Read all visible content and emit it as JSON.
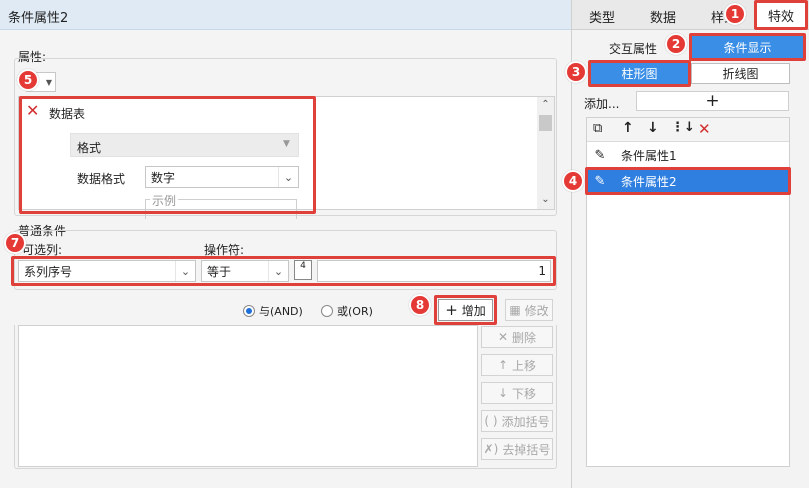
{
  "dialog_title": "条件属性2",
  "left": {
    "properties_label": "属性:",
    "datasheet_label": "数据表",
    "format_label": "格式",
    "data_format_label": "数据格式",
    "data_format_value": "数字",
    "example_label": "示例",
    "common_conditions_label": "普通条件",
    "filter_column_label": "可选列:",
    "filter_column_value": "系列序号",
    "operator_label": "操作符:",
    "operator_value": "等于",
    "value_input": "1",
    "and_label": "与(AND)",
    "or_label": "或(OR)",
    "add_label": "增加",
    "modify_label": "修改",
    "delete_label": "删除",
    "move_up_label": "上移",
    "move_down_label": "下移",
    "add_bracket_label": "添加括号",
    "remove_bracket_label": "去掉括号"
  },
  "right": {
    "tabs": [
      "类型",
      "数据",
      "样式",
      "特效"
    ],
    "sub_tabs": [
      "交互属性",
      "条件显示"
    ],
    "chart_tabs": [
      "柱形图",
      "折线图"
    ],
    "add_label": "添加...",
    "add_button": "+",
    "items": [
      "条件属性1",
      "条件属性2"
    ]
  },
  "badges": [
    "1",
    "2",
    "3",
    "4",
    "5",
    "7",
    "8"
  ],
  "colors": {
    "accent": "#3a8ee6",
    "highlight_red": "#e0403a",
    "selected_item": "#2f7fe0"
  }
}
